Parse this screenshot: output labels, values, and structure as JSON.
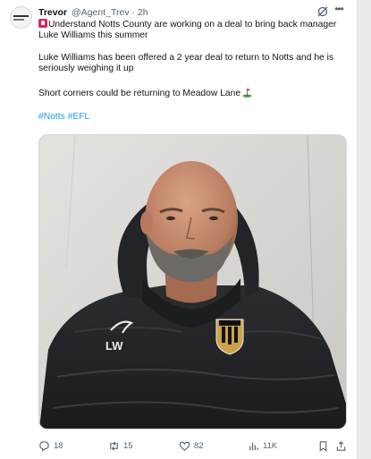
{
  "author": {
    "name": "Trevor",
    "handle": "@Agent_Trev",
    "separator": "·",
    "time": "2h"
  },
  "tweet": {
    "line1": "Understand Notts County are working on a deal to bring back manager Luke Williams this summer",
    "line2": "Luke Williams has been offered a 2 year deal to return to Notts and he is seriously weighing it up",
    "line3": "Short corners could be returning to Meadow Lane",
    "hashtag1": "#Notts",
    "hashtag2": "#EFL"
  },
  "media": {
    "kit_initials": "LW"
  },
  "actions": {
    "replies": "18",
    "reposts": "15",
    "likes": "82",
    "views": "11K"
  },
  "icons": [
    "siren-emoji",
    "golf-flag-emoji",
    "grok-icon",
    "more-icon",
    "reply-icon",
    "repost-icon",
    "like-icon",
    "views-icon",
    "bookmark-icon",
    "share-icon"
  ],
  "colors": {
    "link": "#1d9bf0",
    "text": "#0f1419",
    "muted": "#536471"
  }
}
